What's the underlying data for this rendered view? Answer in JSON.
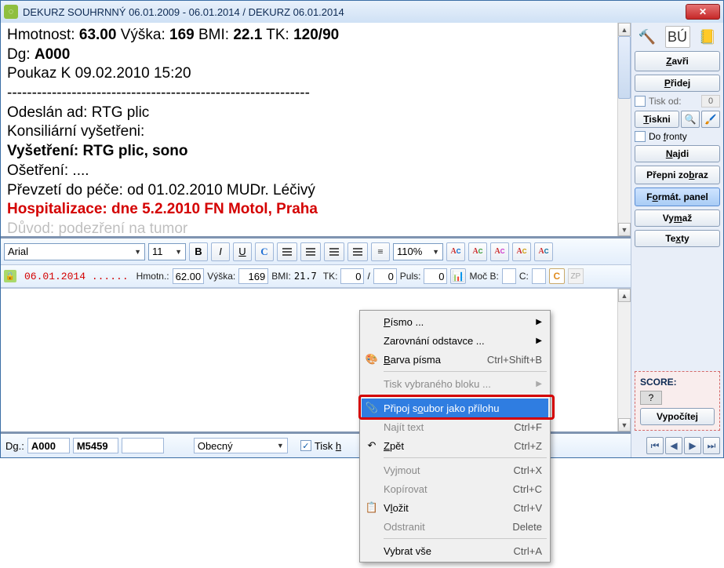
{
  "title": "DEKURZ SOUHRNNÝ 06.01.2009 - 06.01.2014 / DEKURZ 06.01.2014",
  "doc": {
    "l1a": "Hmotnost: ",
    "l1b": "63.00",
    "l1c": " Výška: ",
    "l1d": "169",
    "l1e": " BMI: ",
    "l1f": "22.1",
    "l1g": " TK: ",
    "l1h": "120/90",
    "l2a": "Dg: ",
    "l2b": "A000",
    "l3": "Poukaz K 09.02.2010  15:20",
    "dashes": "-------------------------------------------------------------",
    "l5": "Odeslán ad: RTG plic",
    "l6": "Konsiliární vyšetřeni:",
    "l7a": "Vyšetření: RTG plic, sono",
    "l8": "Ošetření: ....",
    "l9": "Převzetí do péče: od 01.02.2010 MUDr. Léčivý",
    "l10": "Hospitalizace: dne 5.2.2010 FN Motol, Praha",
    "l11": "Důvod: podezření na tumor"
  },
  "fmt": {
    "font": "Arial",
    "size": "11",
    "zoom": "110%"
  },
  "vitals": {
    "date": "06.01.2014 ......",
    "hmotn_label": "Hmotn.:",
    "hmotn": "62.00",
    "vyska_label": "Výška:",
    "vyska": "169",
    "bmi_label": "BMI:",
    "bmi": "21.7",
    "tk_label": "TK:",
    "tk1": "0",
    "tk2": "0",
    "puls_label": "Puls:",
    "puls": "0",
    "mocb_label": "Moč B:",
    "c_label": "C:"
  },
  "dg": {
    "label": "Dg.:",
    "v1": "A000",
    "v2": "M5459",
    "v3": "",
    "combo": "Obecný",
    "tisk_label": "Tisk h"
  },
  "right": {
    "bu": "BÚ",
    "zavri": "Zavři",
    "pridej": "Přidej",
    "tisk_od": "Tisk od:",
    "tisk_od_val": "0",
    "tiskni": "Tiskni",
    "do_fronty": "Do fronty",
    "najdi": "Najdi",
    "prepni": "Přepni zobraz",
    "format_panel": "Formát. panel",
    "vymaz": "Vymaž",
    "texty": "Texty",
    "score": "SCORE:",
    "q": "?",
    "vypocitej": "Vypočítej"
  },
  "menu": {
    "pismo": "Písmo ...",
    "zarovnani": "Zarovnání odstavce ...",
    "barva": "Barva písma",
    "barva_sc": "Ctrl+Shift+B",
    "tisk_blok": "Tisk vybraného bloku ...",
    "pripoj": "Připoj soubor jako přílohu",
    "najit": "Najít text",
    "najit_sc": "Ctrl+F",
    "zpet": "Zpět",
    "zpet_sc": "Ctrl+Z",
    "vyjmout": "Vyjmout",
    "vyjmout_sc": "Ctrl+X",
    "kopirovat": "Kopírovat",
    "kopirovat_sc": "Ctrl+C",
    "vlozit": "Vložit",
    "vlozit_sc": "Ctrl+V",
    "odstranit": "Odstranit",
    "odstranit_sc": "Delete",
    "vybrat": "Vybrat vše",
    "vybrat_sc": "Ctrl+A"
  }
}
